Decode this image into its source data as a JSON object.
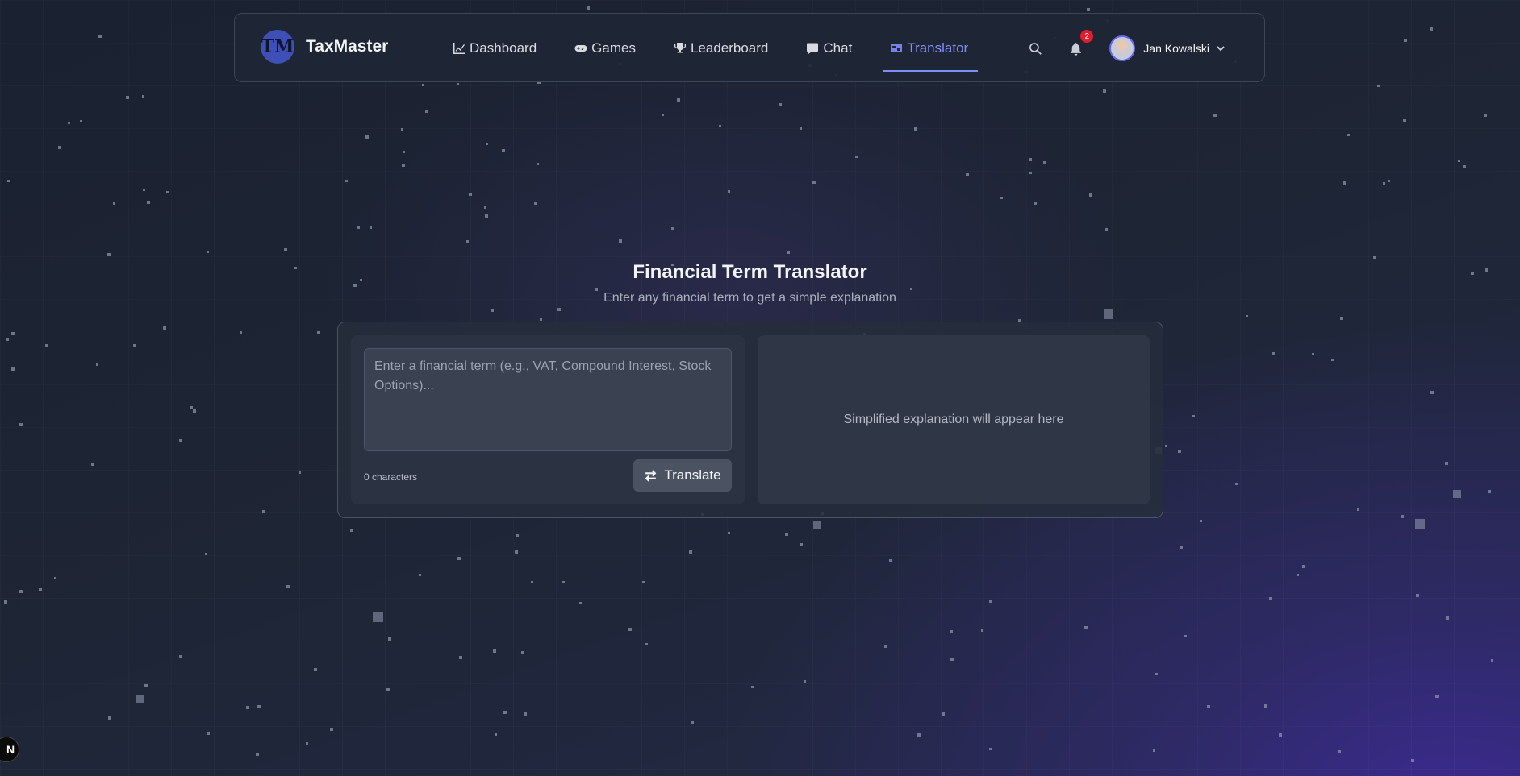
{
  "app": {
    "name": "TaxMaster",
    "logo_letters": "TM"
  },
  "nav": {
    "links": [
      {
        "label": "Dashboard",
        "icon": "chart-line-icon"
      },
      {
        "label": "Games",
        "icon": "gamepad-icon"
      },
      {
        "label": "Leaderboard",
        "icon": "trophy-icon"
      },
      {
        "label": "Chat",
        "icon": "chat-bubble-icon"
      },
      {
        "label": "Translator",
        "icon": "translate-flag-icon",
        "active": true
      }
    ],
    "notifications_count": "2",
    "user_name": "Jan Kowalski"
  },
  "translator": {
    "title": "Financial Term Translator",
    "subtitle": "Enter any financial term to get a simple explanation",
    "input_placeholder": "Enter a financial term (e.g., VAT, Compound Interest, Stock Options)...",
    "input_value": "",
    "char_count": "0 characters",
    "translate_label": "Translate",
    "output_placeholder": "Simplified explanation will appear here"
  },
  "colors": {
    "accent": "#818cf8",
    "badge": "#e11d2e",
    "logo_bg": "#3f4fb8"
  },
  "dev_badge": "N"
}
